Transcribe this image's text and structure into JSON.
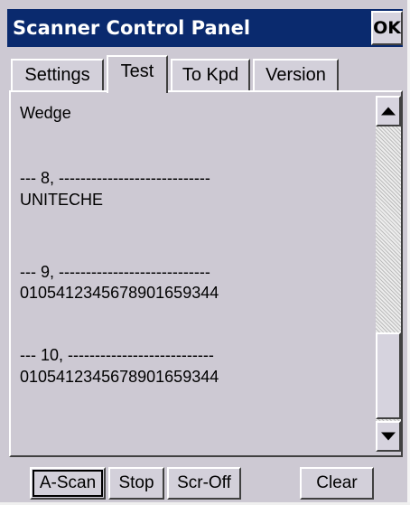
{
  "window": {
    "title": "Scanner Control Panel",
    "ok_label": "OK"
  },
  "tabs": [
    {
      "label": "Settings",
      "active": false
    },
    {
      "label": "Test",
      "active": true
    },
    {
      "label": "To Kpd",
      "active": false
    },
    {
      "label": "Version",
      "active": false
    }
  ],
  "output_lines": [
    "Wedge",
    "--- 8, ----------------------------",
    "UNITECHE",
    "--- 9, ----------------------------",
    "010541234567890165934​4",
    "--- 10, ---------------------------",
    "01054123456789016593​44"
  ],
  "scrollbar": {
    "up_icon": "up-arrow-icon",
    "down_icon": "down-arrow-icon",
    "position": 0.85
  },
  "buttons": {
    "a_scan": "A-Scan",
    "stop": "Stop",
    "scr_off": "Scr-Off",
    "clear": "Clear"
  },
  "colors": {
    "titlebar": "#0a2a6e",
    "background": "#cdc9d3"
  }
}
